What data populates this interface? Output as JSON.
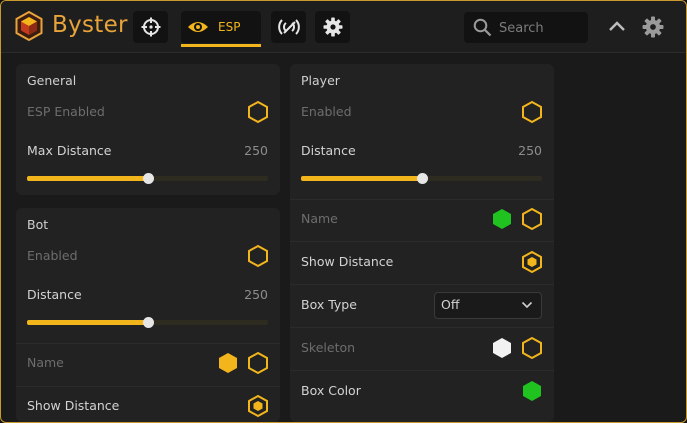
{
  "app": {
    "title": "Byster"
  },
  "nav": {
    "tabs": [
      {
        "icon": "crosshair-icon"
      },
      {
        "icon": "eye-icon",
        "label": "ESP",
        "active": true
      },
      {
        "icon": "radar-icon"
      },
      {
        "icon": "gear-icon"
      }
    ]
  },
  "search": {
    "placeholder": "Search",
    "value": ""
  },
  "colors": {
    "accent": "#f2b51c",
    "brand": "#e8a33a",
    "green": "#1fc21f",
    "white": "#f2f2f2"
  },
  "general": {
    "title": "General",
    "esp_enabled": {
      "label": "ESP Enabled",
      "checked": false
    },
    "max_distance": {
      "label": "Max Distance",
      "value": "250",
      "fraction": 0.5
    }
  },
  "bot": {
    "title": "Bot",
    "enabled": {
      "label": "Enabled",
      "checked": false
    },
    "distance": {
      "label": "Distance",
      "value": "250",
      "fraction": 0.5
    },
    "name": {
      "label": "Name",
      "color": "#f2b51c",
      "checked": false
    },
    "show_distance": {
      "label": "Show Distance",
      "checked": true
    }
  },
  "player": {
    "title": "Player",
    "enabled": {
      "label": "Enabled",
      "checked": false
    },
    "distance": {
      "label": "Distance",
      "value": "250",
      "fraction": 0.5
    },
    "name": {
      "label": "Name",
      "color": "#1fc21f",
      "checked": false
    },
    "show_distance": {
      "label": "Show Distance",
      "checked": true
    },
    "box_type": {
      "label": "Box Type",
      "value": "Off"
    },
    "skeleton": {
      "label": "Skeleton",
      "color": "#f2f2f2",
      "checked": false
    },
    "box_color": {
      "label": "Box Color",
      "color": "#1fc21f"
    }
  }
}
